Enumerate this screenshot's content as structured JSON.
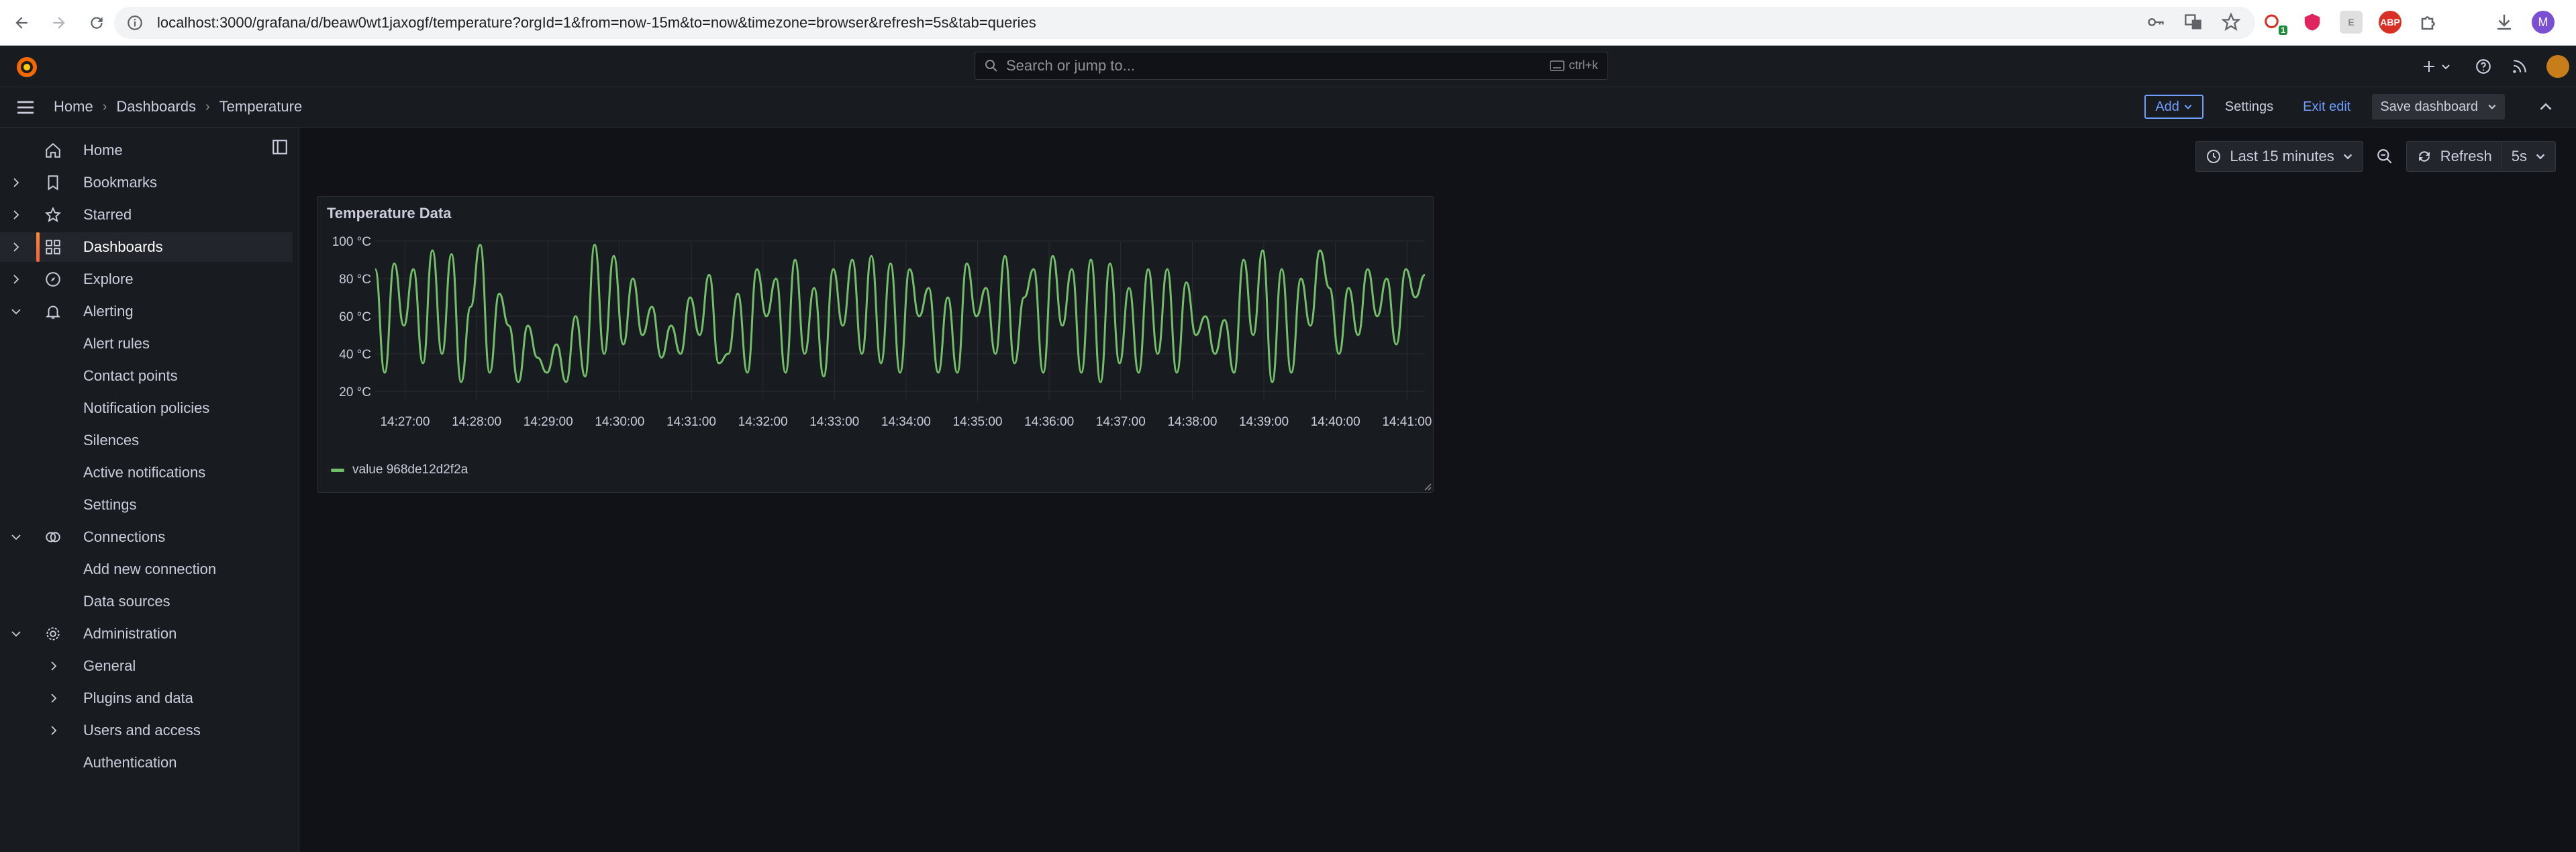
{
  "browser": {
    "url": "localhost:3000/grafana/d/beaw0wt1jaxogf/temperature?orgId=1&from=now-15m&to=now&timezone=browser&refresh=5s&tab=queries",
    "profile_initial": "M",
    "ext_badge": "1"
  },
  "topbar": {
    "search_placeholder": "Search or jump to...",
    "search_shortcut": "ctrl+k"
  },
  "breadcrumb": {
    "items": [
      "Home",
      "Dashboards",
      "Temperature"
    ]
  },
  "actions": {
    "add_label": "Add",
    "settings_label": "Settings",
    "exit_edit_label": "Exit edit",
    "save_label": "Save dashboard"
  },
  "sidebar": {
    "items": [
      {
        "label": "Home",
        "icon": "home-icon"
      },
      {
        "label": "Bookmarks",
        "icon": "bookmark-icon"
      },
      {
        "label": "Starred",
        "icon": "star-icon"
      },
      {
        "label": "Dashboards",
        "icon": "apps-icon"
      },
      {
        "label": "Explore",
        "icon": "compass-icon"
      },
      {
        "label": "Alerting",
        "icon": "bell-icon"
      },
      {
        "label": "Alert rules"
      },
      {
        "label": "Contact points"
      },
      {
        "label": "Notification policies"
      },
      {
        "label": "Silences"
      },
      {
        "label": "Active notifications"
      },
      {
        "label": "Settings"
      },
      {
        "label": "Connections",
        "icon": "connections-icon"
      },
      {
        "label": "Add new connection"
      },
      {
        "label": "Data sources"
      },
      {
        "label": "Administration",
        "icon": "cog-icon"
      },
      {
        "label": "General"
      },
      {
        "label": "Plugins and data"
      },
      {
        "label": "Users and access"
      },
      {
        "label": "Authentication"
      }
    ]
  },
  "time": {
    "range_label": "Last 15 minutes",
    "refresh_label": "Refresh",
    "interval": "5s"
  },
  "panel": {
    "title": "Temperature Data",
    "legend": "value 968de12d2f2a",
    "series_color": "#73bf69"
  },
  "chart_data": {
    "type": "line",
    "title": "Temperature Data",
    "y_ticks": [
      "20 °C",
      "40 °C",
      "60 °C",
      "80 °C",
      "100 °C"
    ],
    "ylim": [
      15,
      100
    ],
    "x_ticks": [
      "14:27:00",
      "14:28:00",
      "14:29:00",
      "14:30:00",
      "14:31:00",
      "14:32:00",
      "14:33:00",
      "14:34:00",
      "14:35:00",
      "14:36:00",
      "14:37:00",
      "14:38:00",
      "14:39:00",
      "14:40:00",
      "14:41:00"
    ],
    "x_start": "14:26:35",
    "x_end": "14:41:15",
    "series": [
      {
        "name": "value 968de12d2f2a",
        "values": [
          85,
          30,
          88,
          55,
          85,
          35,
          95,
          40,
          93,
          25,
          65,
          98,
          30,
          72,
          55,
          25,
          55,
          38,
          30,
          45,
          25,
          60,
          28,
          98,
          40,
          92,
          45,
          80,
          50,
          65,
          38,
          55,
          40,
          70,
          50,
          82,
          35,
          40,
          72,
          30,
          85,
          60,
          80,
          30,
          90,
          40,
          75,
          28,
          85,
          55,
          90,
          40,
          92,
          35,
          88,
          30,
          85,
          60,
          75,
          30,
          70,
          30,
          88,
          60,
          75,
          40,
          92,
          35,
          70,
          85,
          30,
          92,
          55,
          85,
          30,
          90,
          25,
          88,
          35,
          75,
          30,
          85,
          40,
          85,
          30,
          78,
          50,
          60,
          40,
          58,
          30,
          90,
          50,
          95,
          25,
          85,
          30,
          80,
          55,
          95,
          75,
          40,
          75,
          50,
          85,
          60,
          80,
          45,
          85,
          70,
          82
        ],
        "color": "#73bf69"
      }
    ]
  }
}
